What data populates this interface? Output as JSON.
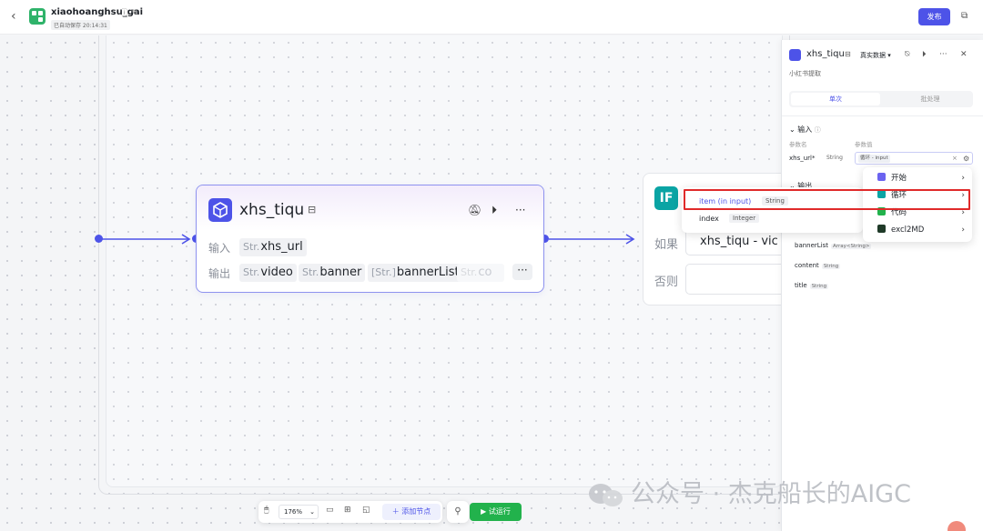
{
  "header": {
    "title": "xiaohoanghsu_gai",
    "save_status": "已自动保存 20:14:31",
    "publish_label": "发布"
  },
  "node": {
    "title": "xhs_tiqu",
    "input_label": "输入",
    "output_label": "输出",
    "inputs": [
      {
        "type": "Str.",
        "name": "xhs_url"
      }
    ],
    "outputs": [
      {
        "type": "Str.",
        "name": "video"
      },
      {
        "type": "Str.",
        "name": "banner"
      },
      {
        "type": "[Str.]",
        "name": "bannerList"
      },
      {
        "type": "Str.",
        "name": "co"
      }
    ],
    "more_label": "···"
  },
  "if_node": {
    "icon_text": "IF",
    "if_label": "如果",
    "else_label": "否则",
    "condition": "xhs_tiqu  -  vic"
  },
  "panel": {
    "title": "xhs_tiqu",
    "data_mode": "真实数据",
    "description": "小红书提取",
    "tab_single": "单次",
    "tab_batch": "批处理",
    "input_section": "输入",
    "col_param_name": "参数名",
    "col_param_value": "参数值",
    "param_name": "xhs_url*",
    "param_type": "String",
    "param_value_tag": "循环 - input",
    "output_section": "输出",
    "outputs": [
      {
        "name": "bannerList",
        "type": "Array<String>"
      },
      {
        "name": "content",
        "type": "String"
      },
      {
        "name": "title",
        "type": "String"
      }
    ]
  },
  "dropdown": {
    "variables": [
      {
        "name": "item (in input)",
        "type": "String"
      },
      {
        "name": "index",
        "type": "Integer"
      }
    ],
    "nodes": [
      {
        "name": "开始",
        "color": "#6b63f0"
      },
      {
        "name": "循环",
        "color": "#0aa4a4"
      },
      {
        "name": "代码",
        "color": "#22b24c"
      },
      {
        "name": "excl2MD",
        "color": "#1f3a28"
      }
    ]
  },
  "toolbar": {
    "zoom": "176%",
    "add_node_label": "添加节点",
    "test_run_label": "试运行"
  },
  "watermark": "公众号 · 杰克船长的AIGC",
  "colors": {
    "accent": "#4d53e8",
    "run_green": "#22b24c",
    "highlight_red": "#e02a2a"
  }
}
